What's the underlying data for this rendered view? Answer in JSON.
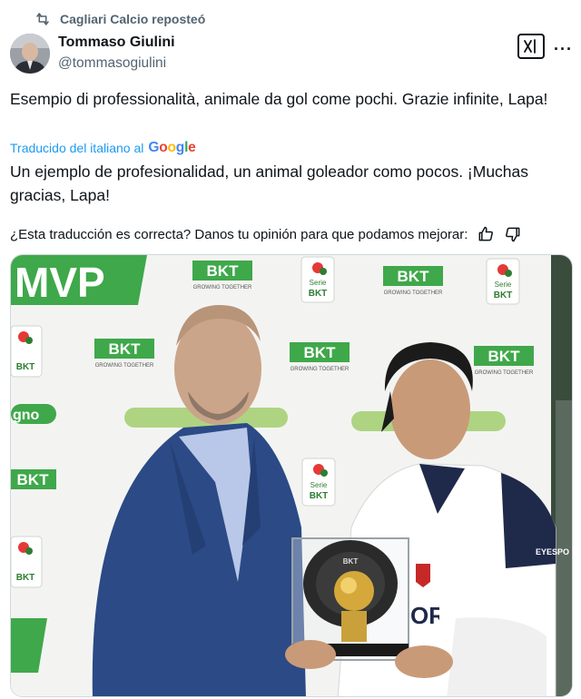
{
  "repost": {
    "text": "Cagliari Calcio reposteó",
    "icon": "repost-icon"
  },
  "author": {
    "name": "Tommaso Giulini",
    "handle": "@tommasogiulini"
  },
  "post": {
    "original_text": "Esempio di professionalità, animale da gol come pochi. Grazie infinite, Lapa!",
    "translated_label": "Traducido del italiano al",
    "translator": "Google",
    "translated_text": "Un ejemplo de profesionalidad, un animal goleador como pocos. ¡Muchas gracias, Lapa!",
    "feedback_prompt": "¿Esta traducción es correcta? Danos tu opinión para que podamos mejorar:"
  },
  "media": {
    "backdrop": {
      "mvp": "MVP",
      "sponsor": "BKT",
      "sponsor_tagline": "GROWING TOGETHER",
      "league_top": "Serie",
      "league_bottom": "BKT",
      "hashtag_fragment": "gno"
    },
    "jersey": {
      "sponsor": "ORSID",
      "badge": "EYESPO"
    },
    "trophy_label": "BKT"
  },
  "colors": {
    "accent_blue": "#1d9bf0",
    "bkt_green": "#4caf50",
    "suit_blue": "#2b4a86",
    "google_blue": "#4285f4"
  }
}
